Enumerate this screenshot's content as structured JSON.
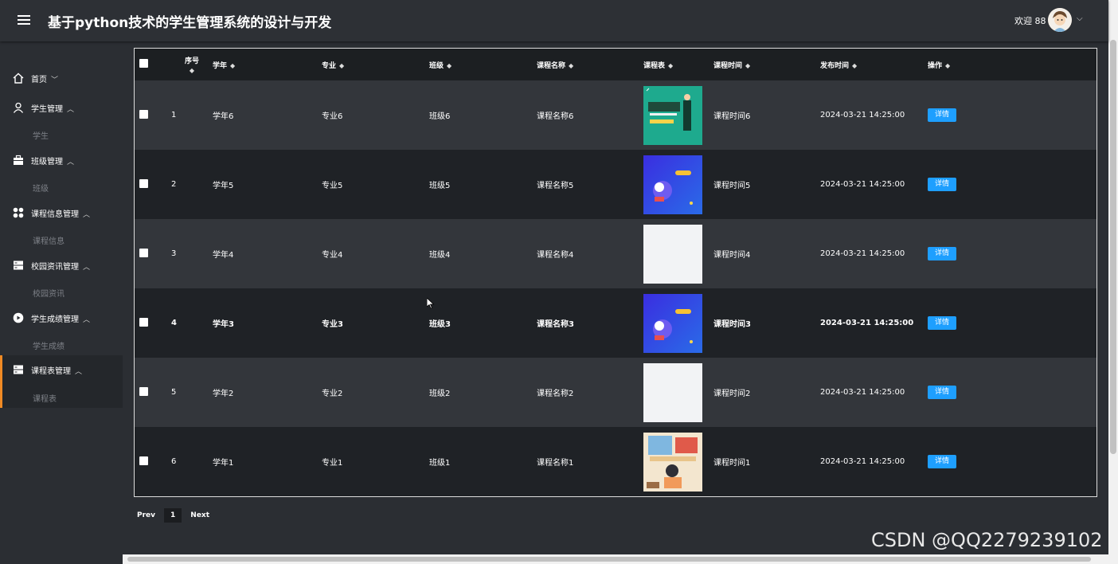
{
  "header": {
    "title": "基于python技术的学生管理系统的设计与开发",
    "welcome": "欢迎 88"
  },
  "sidebar": {
    "items": [
      {
        "label": "首页",
        "icon": "home-icon"
      },
      {
        "label": "学生管理",
        "icon": "user-icon",
        "sub": "学生"
      },
      {
        "label": "班级管理",
        "icon": "briefcase-icon",
        "sub": "班级"
      },
      {
        "label": "课程信息管理",
        "icon": "grid-icon",
        "sub": "课程信息"
      },
      {
        "label": "校园资讯管理",
        "icon": "server-icon",
        "sub": "校园资讯"
      },
      {
        "label": "学生成绩管理",
        "icon": "circle-play-icon",
        "sub": "学生成绩"
      },
      {
        "label": "课程表管理",
        "icon": "server-icon",
        "sub": "课程表",
        "active": true
      }
    ]
  },
  "table": {
    "columns": [
      "序号",
      "学年",
      "专业",
      "班级",
      "课程名称",
      "课程表",
      "课程时间",
      "发布时间",
      "操作"
    ],
    "rows": [
      {
        "index": "1",
        "year": "学年6",
        "major": "专业6",
        "class": "班级6",
        "course": "课程名称6",
        "image": "green-poster",
        "time": "课程时间6",
        "published": "2024-03-21 14:25:00",
        "action": "详情"
      },
      {
        "index": "2",
        "year": "学年5",
        "major": "专业5",
        "class": "班级5",
        "course": "课程名称5",
        "image": "blue-illustration",
        "time": "课程时间5",
        "published": "2024-03-21 14:25:00",
        "action": "详情"
      },
      {
        "index": "3",
        "year": "学年4",
        "major": "专业4",
        "class": "班级4",
        "course": "课程名称4",
        "image": "blank",
        "time": "课程时间4",
        "published": "2024-03-21 14:25:00",
        "action": "详情"
      },
      {
        "index": "4",
        "year": "学年3",
        "major": "专业3",
        "class": "班级3",
        "course": "课程名称3",
        "image": "blue-illustration",
        "time": "课程时间3",
        "published": "2024-03-21 14:25:00",
        "action": "详情"
      },
      {
        "index": "5",
        "year": "学年2",
        "major": "专业2",
        "class": "班级2",
        "course": "课程名称2",
        "image": "blank",
        "time": "课程时间2",
        "published": "2024-03-21 14:25:00",
        "action": "详情"
      },
      {
        "index": "6",
        "year": "学年1",
        "major": "专业1",
        "class": "班级1",
        "course": "课程名称1",
        "image": "classroom-illustration",
        "time": "课程时间1",
        "published": "2024-03-21 14:25:00",
        "action": "详情"
      }
    ]
  },
  "pagination": {
    "prev": "Prev",
    "page": "1",
    "next": "Next"
  },
  "watermark": "CSDN @QQ2279239102",
  "colors": {
    "accent": "#1e9fff",
    "active_indicator": "#f08a24",
    "sidebar_bg": "#2b2e33"
  }
}
